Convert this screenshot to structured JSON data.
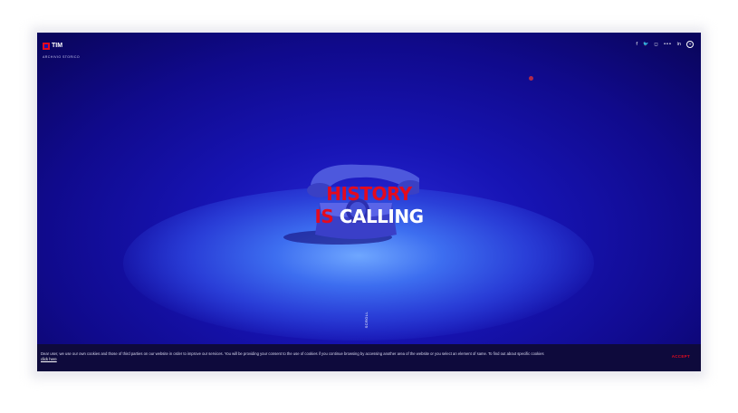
{
  "brand": {
    "name": "TIM",
    "subtitle": "ARCHIVIO STORICO"
  },
  "social": {
    "facebook": "f",
    "twitter": "🐦",
    "instagram": "◻",
    "flickr": "•••",
    "linkedin": "in",
    "more": "+"
  },
  "hero": {
    "line1_red": "HISTORY",
    "line2_red": "IS",
    "line2_white": "CALLING"
  },
  "scroll_label": "SCROLL",
  "cookie": {
    "text": "Dear user, we use our own cookies and those of third parties on our website in order to improve our services. You will be providing your consent to the use of cookies if you continue browsing by accessing another area of the website or you select an element of same. To find out about specific cookies",
    "link": "click here",
    "accept": "ACCEPT"
  },
  "colors": {
    "accent_red": "#e40a1e",
    "background_blue": "#1714b4",
    "cookie_bar": "#0e0a3c"
  }
}
